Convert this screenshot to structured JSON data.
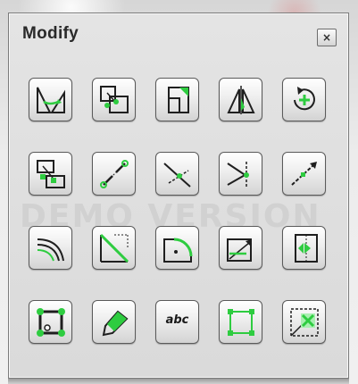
{
  "window": {
    "title": "Modify",
    "close_label": "☒"
  },
  "watermark": "DEMO VERSION",
  "colors": {
    "accent_green": "#2ecc40",
    "icon_dark": "#1f1f1f"
  },
  "tools": [
    {
      "icon": "mirror-icon"
    },
    {
      "icon": "copy-icon"
    },
    {
      "icon": "scale-icon"
    },
    {
      "icon": "mirror-axis-icon"
    },
    {
      "icon": "rotate-icon"
    },
    {
      "icon": "move-icon"
    },
    {
      "icon": "join-icon"
    },
    {
      "icon": "trim-icon"
    },
    {
      "icon": "extend-icon"
    },
    {
      "icon": "lengthen-icon"
    },
    {
      "icon": "offset-icon"
    },
    {
      "icon": "chamfer-icon"
    },
    {
      "icon": "fillet-icon"
    },
    {
      "icon": "stretch-icon"
    },
    {
      "icon": "array-icon"
    },
    {
      "icon": "explode-icon"
    },
    {
      "icon": "edit-icon"
    },
    {
      "icon": "text-edit-icon",
      "label": "abc"
    },
    {
      "icon": "grip-select-icon"
    },
    {
      "icon": "delete-icon"
    }
  ]
}
